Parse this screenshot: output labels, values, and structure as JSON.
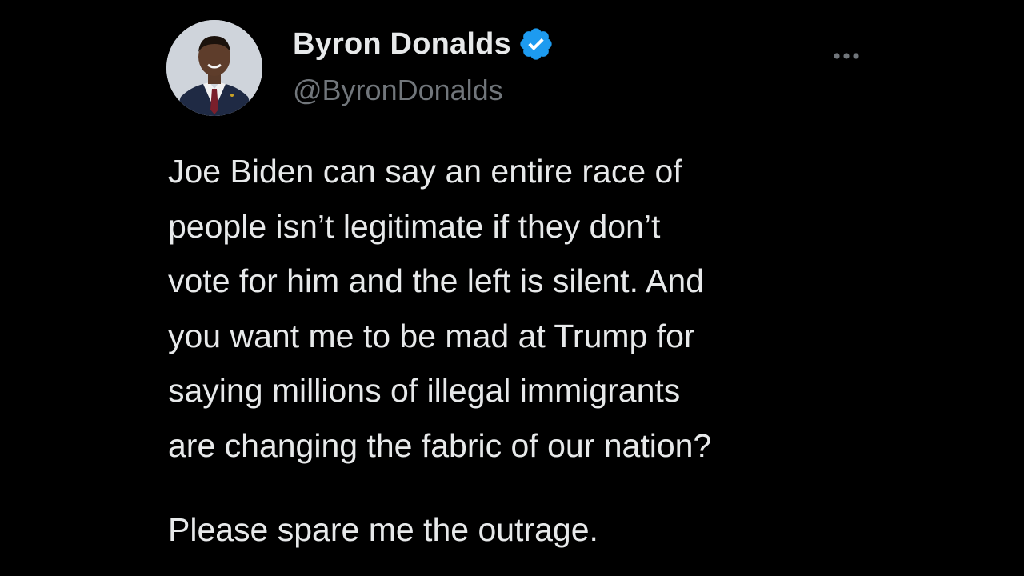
{
  "author": {
    "display_name": "Byron Donalds",
    "handle": "@ByronDonalds",
    "verified": true,
    "avatar_icon": "profile-photo"
  },
  "tweet": {
    "paragraph1_lines": [
      "Joe Biden can say an entire race of",
      "people isn’t legitimate if they don’t",
      "vote for him and the left is silent. And",
      "you want me to be mad at Trump for",
      "saying millions of illegal immigrants",
      "are changing the fabric of our nation?"
    ],
    "paragraph2": "Please spare me the outrage."
  },
  "icons": {
    "more": "more-horizontal-icon",
    "verified": "verified-badge-icon"
  },
  "colors": {
    "background": "#000000",
    "text": "#e7e9ea",
    "secondary_text": "#71767b",
    "verified_blue": "#1d9bf0"
  }
}
